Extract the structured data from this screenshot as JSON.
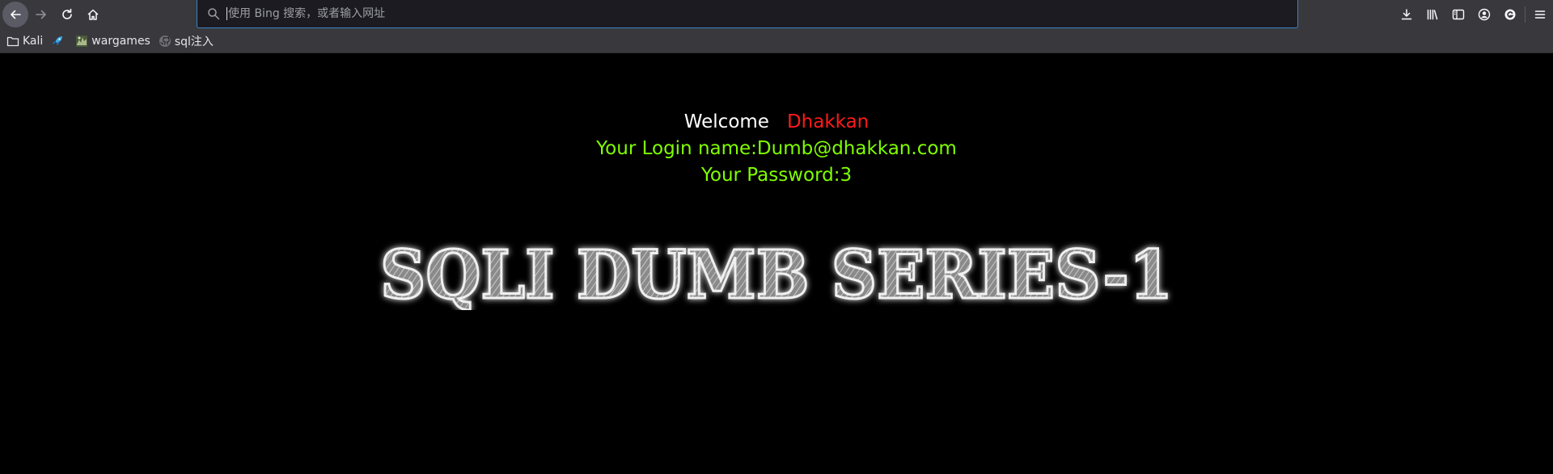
{
  "browser": {
    "urlbar": {
      "placeholder": "使用 Bing 搜索，或者输入网址",
      "value": ""
    },
    "bookmarks": [
      {
        "label": "Kali",
        "icon": "folder-icon"
      },
      {
        "label": "",
        "icon": "rocket-icon"
      },
      {
        "label": "wargames",
        "icon": "wargames-favicon-icon"
      },
      {
        "label": "sql注入",
        "icon": "github-icon"
      }
    ]
  },
  "page": {
    "welcome_label": "Welcome",
    "username": "Dhakkan",
    "login_line": "Your Login name:Dumb@dhakkan.com",
    "password_line": "Your Password:3",
    "banner_text": "SQLI DUMB SERIES-1"
  },
  "colors": {
    "background": "#000000",
    "welcome": "#ffffff",
    "username": "#ff1a1a",
    "info": "#7fff00",
    "urlbar_focus": "#3b82c4"
  }
}
